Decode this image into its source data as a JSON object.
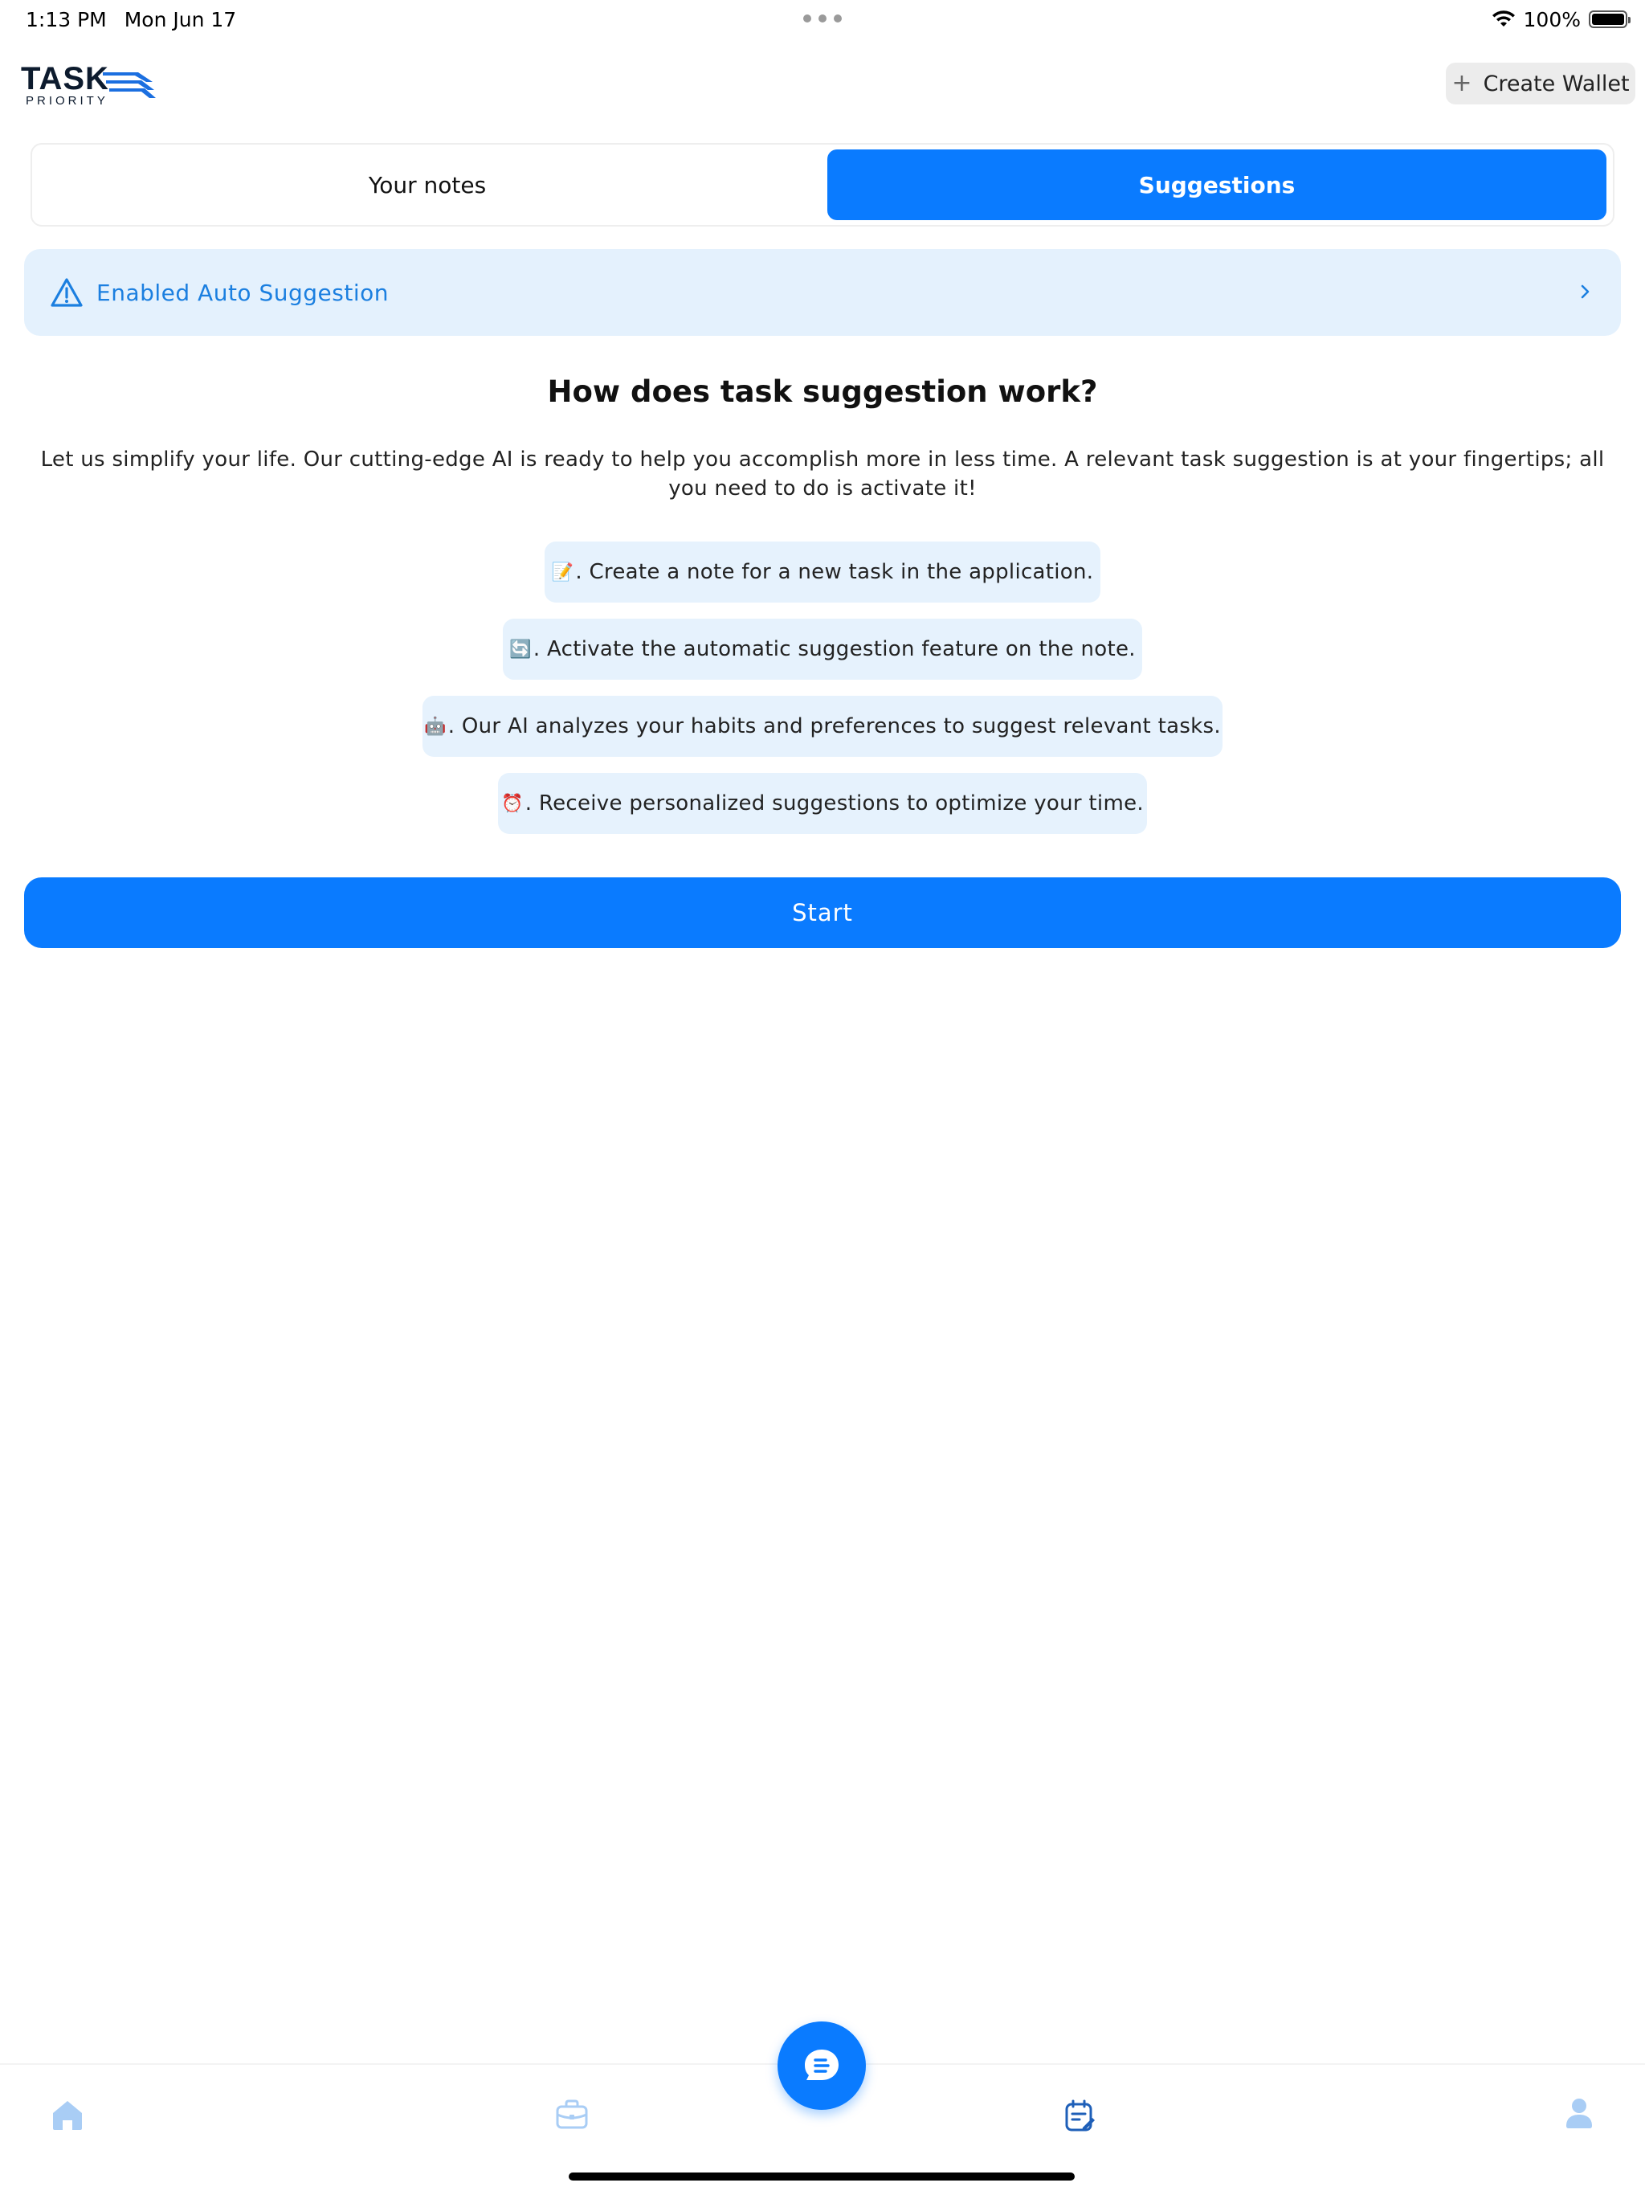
{
  "status_bar": {
    "time": "1:13 PM",
    "date": "Mon Jun 17",
    "battery": "100%"
  },
  "header": {
    "logo_word": "TASK",
    "logo_sub": "PRIORITY",
    "create_wallet_label": "Create Wallet"
  },
  "tabs": [
    {
      "label": "Your notes",
      "active": false
    },
    {
      "label": "Suggestions",
      "active": true
    }
  ],
  "banner": {
    "text": "Enabled Auto Suggestion"
  },
  "content": {
    "title": "How does task suggestion work?",
    "description": "Let us simplify your life. Our cutting-edge AI is ready to help you accomplish more in less time. A relevant task suggestion is at your fingertips; all you need to do is activate it!",
    "steps": [
      {
        "icon": "📝",
        "text": ". Create a note for a new task in the application."
      },
      {
        "icon": "🔄",
        "text": ". Activate the automatic suggestion feature on the note."
      },
      {
        "icon": "🤖",
        "text": ". Our AI analyzes your habits and preferences to suggest relevant tasks."
      },
      {
        "icon": "⏰",
        "text": ". Receive personalized suggestions to optimize your time."
      }
    ],
    "start_label": "Start"
  },
  "bottom_nav": {
    "items": [
      "home-icon",
      "briefcase-icon",
      "chat-fab-icon",
      "notes-icon",
      "profile-icon"
    ],
    "accent": "#0a7bff"
  },
  "colors": {
    "accent": "#0a7bff",
    "banner_bg": "#e4f1fd",
    "banner_text": "#1b7fe0",
    "step_bg": "#e6f2fd"
  }
}
